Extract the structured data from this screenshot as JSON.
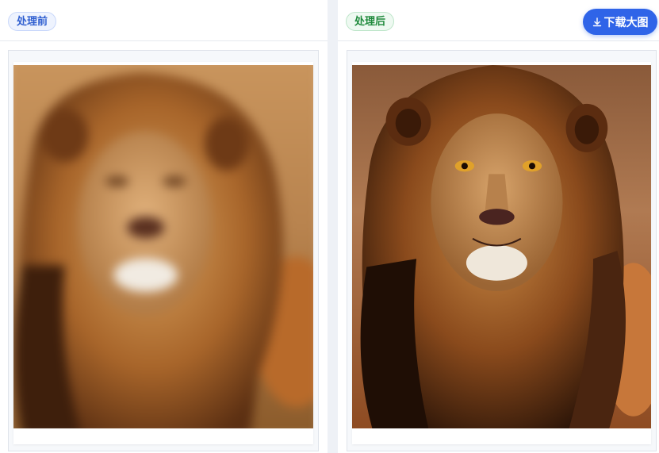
{
  "left_panel": {
    "tag_label": "处理前"
  },
  "right_panel": {
    "tag_label": "处理后"
  },
  "toolbar": {
    "download_label": "下载大图",
    "download_icon": "download-icon"
  },
  "colors": {
    "accent": "#2f64e8",
    "before_tag": "#2f5fd0",
    "after_tag": "#1f8a3c"
  }
}
